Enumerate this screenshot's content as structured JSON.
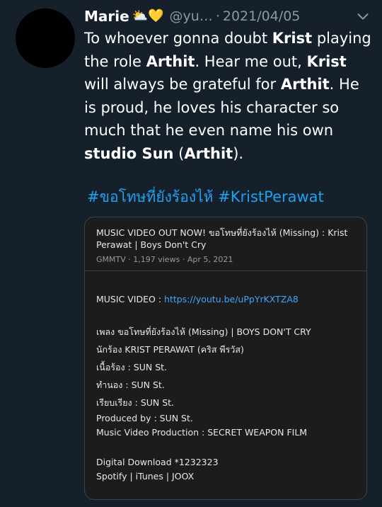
{
  "tweet": {
    "display_name": "Marie",
    "emojis": "⛅💛",
    "handle": "@yu…",
    "dot": "·",
    "date": "2021/04/05",
    "text_parts": [
      {
        "t": "To whoever gonna doubt ",
        "b": false
      },
      {
        "t": "Krist",
        "b": true
      },
      {
        "t": " playing the role ",
        "b": false
      },
      {
        "t": "Arthit",
        "b": true
      },
      {
        "t": ". Hear me out, ",
        "b": false
      },
      {
        "t": "Krist",
        "b": true
      },
      {
        "t": " will always be grateful for ",
        "b": false
      },
      {
        "t": "Arthit",
        "b": true
      },
      {
        "t": ". He is proud, he loves his character so much that he even name his own ",
        "b": false
      },
      {
        "t": "studio Sun",
        "b": true
      },
      {
        "t": " (",
        "b": false
      },
      {
        "t": "Arthit",
        "b": true
      },
      {
        "t": ").",
        "b": false
      }
    ],
    "hashtags": "#ขอโทษที่ยังร้องไห้ #KristPerawat"
  },
  "card": {
    "title": "MUSIC VIDEO OUT NOW! ขอโทษที่ยังร้องไห้ (Missing) : Krist Perawat | Boys Don't Cry",
    "channel": "GMMTV",
    "views": "1,197 views",
    "date": "Apr 5, 2021",
    "meta_sep": "·",
    "mv_label": "MUSIC VIDEO : ",
    "mv_link": "https://youtu.be/uPpYrKXTZA8",
    "lines": [
      "เพลง ขอโทษที่ยังร้องไห้ (Missing) | BOYS DON'T CRY",
      "นักร้อง KRIST PERAWAT (คริส พีรวัส)",
      "เนื้อร้อง : SUN St.",
      "ทำนอง : SUN St.",
      "เรียบเรียง : SUN St.",
      "Produced by : SUN St.",
      "Music Video Production : SECRET WEAPON FILM"
    ],
    "download_lines": [
      "Digital Download *1232323",
      "Spotify | iTunes | JOOX"
    ]
  }
}
